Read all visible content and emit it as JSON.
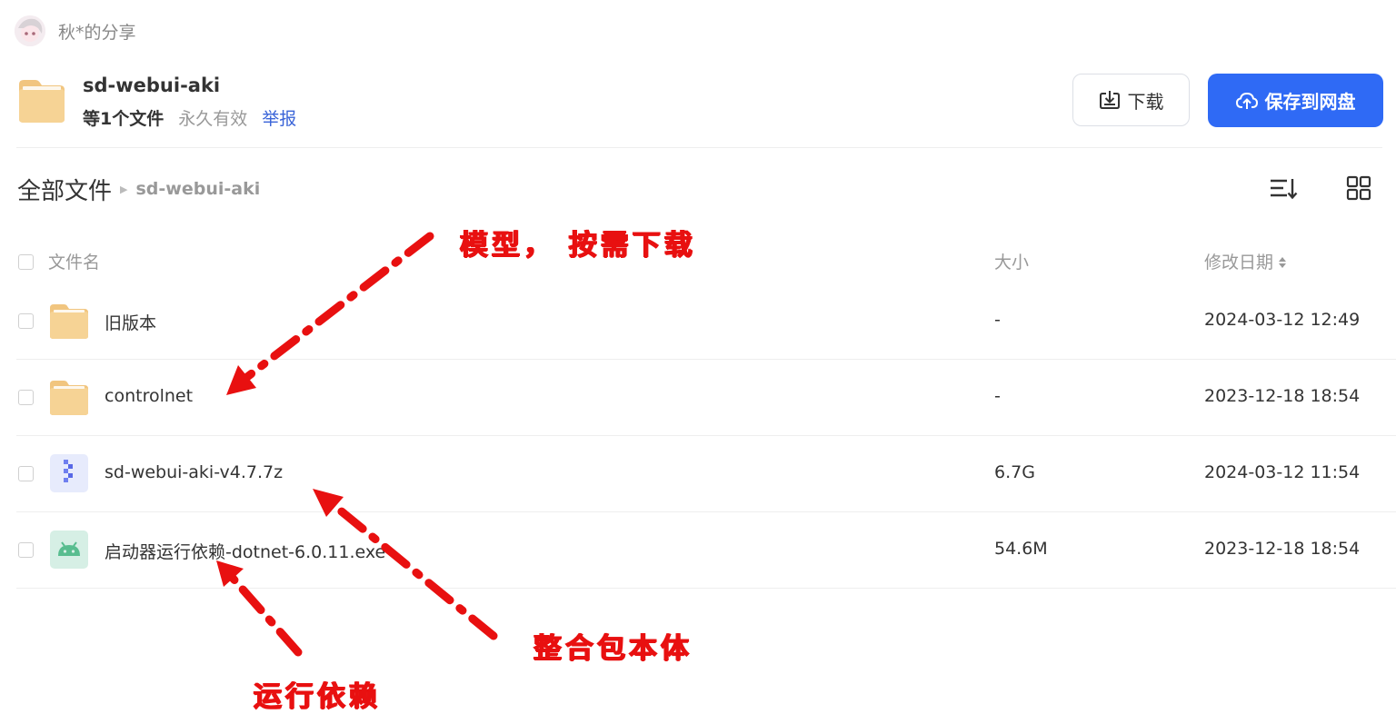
{
  "sharer": {
    "name": "秋*的分享"
  },
  "share": {
    "title": "sd-webui-aki",
    "count": "等1个文件",
    "validity": "永久有效",
    "report": "举报"
  },
  "actions": {
    "download": "下载",
    "save": "保存到网盘"
  },
  "breadcrumb": {
    "root": "全部文件",
    "current": "sd-webui-aki"
  },
  "columns": {
    "name": "文件名",
    "size": "大小",
    "date": "修改日期"
  },
  "files": [
    {
      "name": "旧版本",
      "size": "-",
      "date": "2024-03-12 12:49",
      "icon": "folder-icon"
    },
    {
      "name": "controlnet",
      "size": "-",
      "date": "2023-12-18 18:54",
      "icon": "folder-icon"
    },
    {
      "name": "sd-webui-aki-v4.7.7z",
      "size": "6.7G",
      "date": "2024-03-12 11:54",
      "icon": "zip-archive-icon"
    },
    {
      "name": "启动器运行依赖-dotnet-6.0.11.exe",
      "size": "54.6M",
      "date": "2023-12-18 18:54",
      "icon": "android-exe-icon"
    }
  ],
  "annotations": {
    "models": "模型， 按需下载",
    "package": "整合包本体",
    "deps": "运行依赖"
  },
  "colors": {
    "accent": "#2f6af5",
    "annotation": "#e81010",
    "folder": "#f5c97c"
  }
}
